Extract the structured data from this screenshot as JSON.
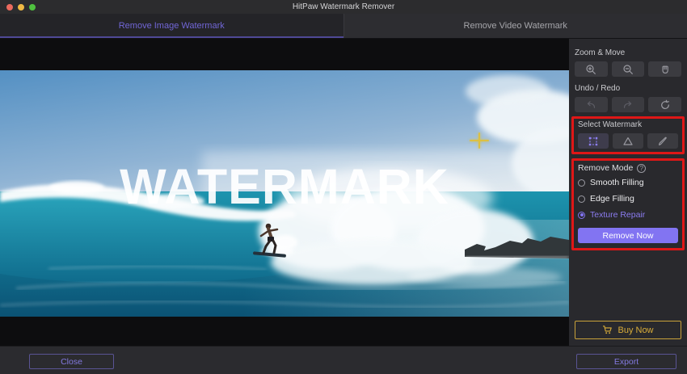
{
  "window": {
    "title": "HitPaw Watermark Remover"
  },
  "tabs": {
    "image": "Remove Image Watermark",
    "video": "Remove Video Watermark"
  },
  "canvas": {
    "watermark_text": "WATERMARK"
  },
  "sidebar": {
    "zoom_move": {
      "label": "Zoom & Move",
      "buttons": [
        "zoom-in",
        "zoom-out",
        "hand"
      ]
    },
    "undo_redo": {
      "label": "Undo / Redo",
      "buttons": [
        "undo",
        "redo",
        "reset"
      ]
    },
    "select_watermark": {
      "label": "Select Watermark",
      "buttons": [
        "marquee",
        "polygon",
        "brush"
      ],
      "selected_tool": "marquee"
    },
    "remove_mode": {
      "label": "Remove Mode",
      "help_glyph": "?",
      "options": [
        {
          "label": "Smooth Filling",
          "selected": false
        },
        {
          "label": "Edge Filling",
          "selected": false
        },
        {
          "label": "Texture Repair",
          "selected": true
        }
      ],
      "remove_now_label": "Remove Now"
    },
    "buy_now_label": "Buy Now"
  },
  "footer": {
    "close_label": "Close",
    "export_label": "Export"
  },
  "colors": {
    "accent_purple": "#8274f2",
    "tab_active_purple": "#7166d6",
    "highlight_red": "#df1717",
    "buy_gold": "#d9ad3a",
    "crosshair_yellow": "#dcc043"
  }
}
